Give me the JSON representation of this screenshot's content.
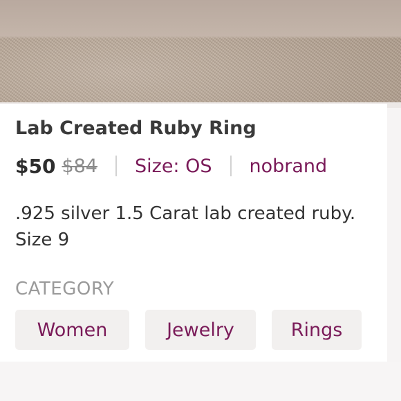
{
  "listing": {
    "title": "Lab Created Ruby Ring",
    "price": "$50",
    "original_price": "$84",
    "size": "Size: OS",
    "brand": "nobrand",
    "description": ".925 silver 1.5 Carat lab created ruby. Size 9"
  },
  "category": {
    "label": "CATEGORY",
    "chips": [
      "Women",
      "Jewelry",
      "Rings"
    ]
  },
  "colors": {
    "accent": "#7a1b59",
    "chip_bg": "#f2f0ef",
    "title_text": "#3a3a3a",
    "muted_text": "#9a9a9a"
  }
}
